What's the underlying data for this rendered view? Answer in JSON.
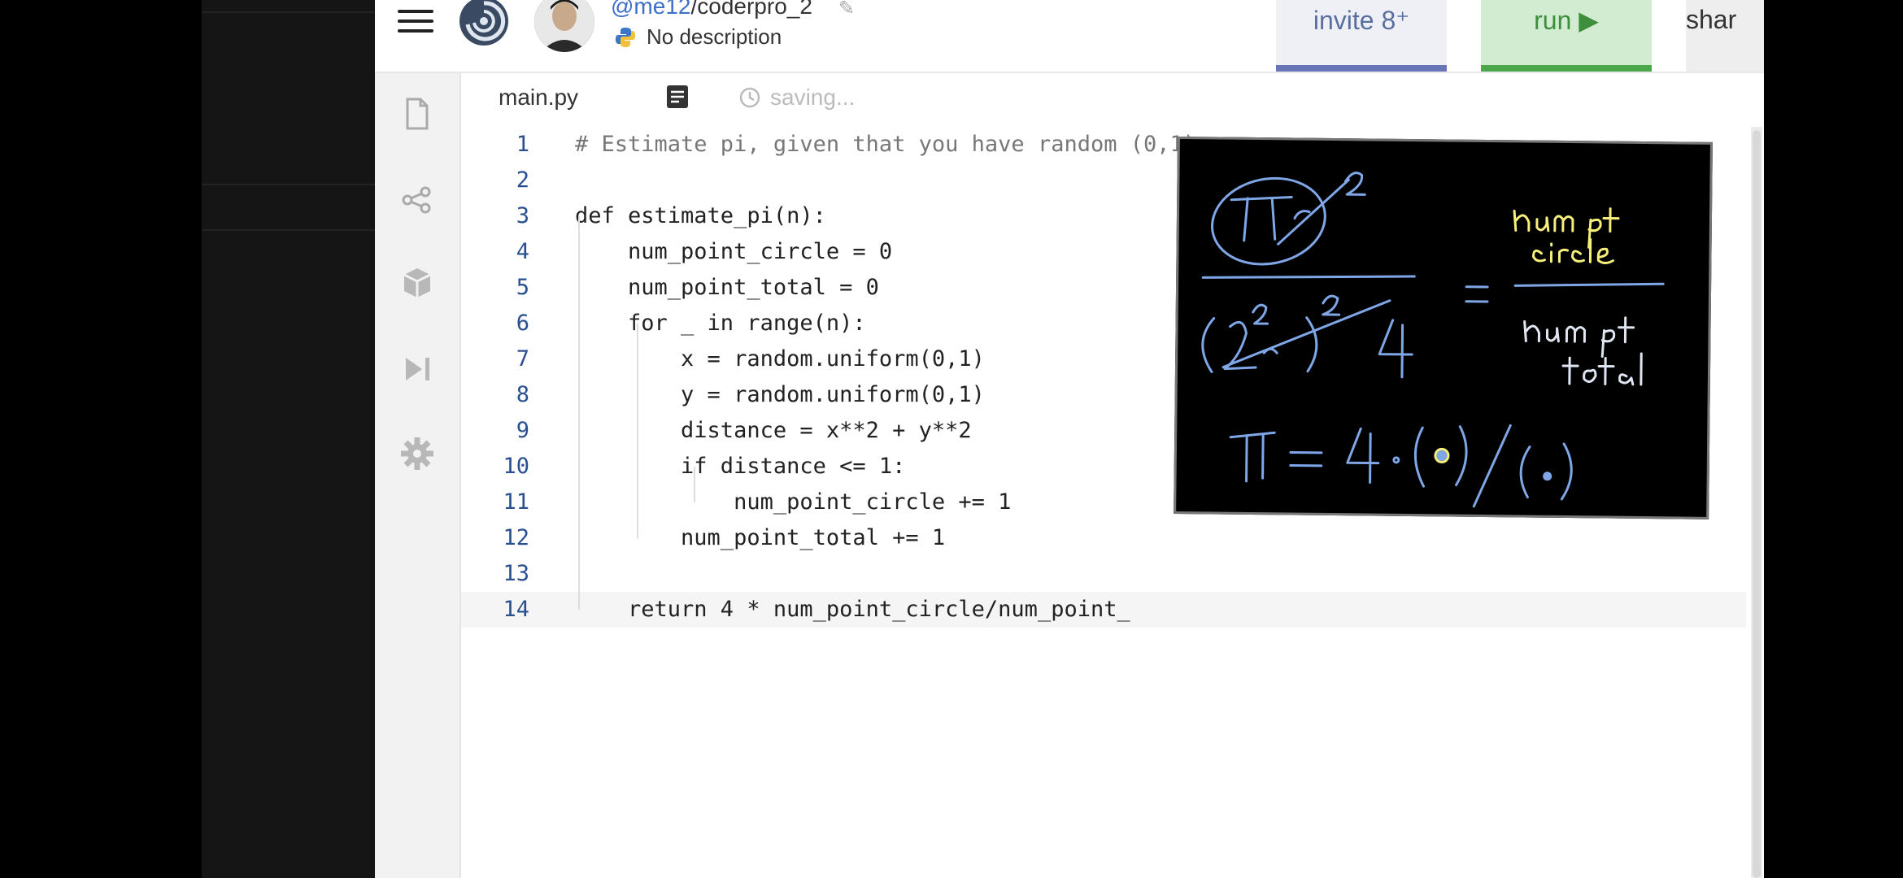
{
  "header": {
    "repo_user": "@me12",
    "repo_sep": "/",
    "repo_name": "coderpro_2",
    "description": "No description",
    "invite_label": "invite 8⁺",
    "run_label": "run ▶",
    "share_label": "shar"
  },
  "sidebar": {
    "icons": [
      "file-icon",
      "share-nodes-icon",
      "package-icon",
      "debugger-icon",
      "settings-gear-icon"
    ]
  },
  "editor": {
    "file_tab": "main.py",
    "status": "saving..."
  },
  "code": {
    "lines": [
      {
        "n": "1",
        "text": "# Estimate pi, given that you have random (0,1)"
      },
      {
        "n": "2",
        "text": ""
      },
      {
        "n": "3",
        "text": "def estimate_pi(n):"
      },
      {
        "n": "4",
        "text": "    num_point_circle = 0"
      },
      {
        "n": "5",
        "text": "    num_point_total = 0"
      },
      {
        "n": "6",
        "text": "    for _ in range(n):"
      },
      {
        "n": "7",
        "text": "        x = random.uniform(0,1)"
      },
      {
        "n": "8",
        "text": "        y = random.uniform(0,1)"
      },
      {
        "n": "9",
        "text": "        distance = x**2 + y**2"
      },
      {
        "n": "10",
        "text": "        if distance <= 1:"
      },
      {
        "n": "11",
        "text": "            num_point_circle += 1"
      },
      {
        "n": "12",
        "text": "        num_point_total += 1"
      },
      {
        "n": "13",
        "text": ""
      },
      {
        "n": "14",
        "text": "    return 4 * num_point_circle/num_point_"
      }
    ],
    "current_line": 14
  },
  "whiteboard": {
    "top_numerator": "πr²",
    "right_numerator_1": "num pt",
    "right_numerator_2": "circle",
    "right_denominator_1": "num pt",
    "right_denominator_2": "total",
    "bottom_formula": "π = 4·(•)/(•)",
    "colors": {
      "blue": "#7fa7e8",
      "yellow": "#f6f07a"
    }
  }
}
